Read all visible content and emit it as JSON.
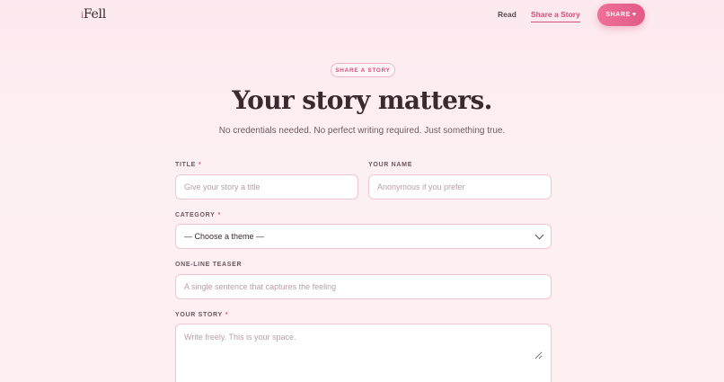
{
  "nav": {
    "logo_prefix": "i",
    "logo_text": "Fell",
    "links": [
      {
        "label": "Read"
      },
      {
        "label": "Share a Story"
      }
    ],
    "cta_label": "SHARE",
    "cta_icon": "heart-icon"
  },
  "hero": {
    "pill": "SHARE A STORY",
    "title": "Your story matters.",
    "subtitle": "No credentials needed. No perfect writing required. Just something true."
  },
  "form": {
    "title": {
      "label": "TITLE",
      "required": "*",
      "placeholder": "Give your story a title"
    },
    "name": {
      "label": "YOUR NAME",
      "placeholder": "Anonymous if you prefer"
    },
    "category": {
      "label": "CATEGORY",
      "required": "*",
      "value": "— Choose a theme —"
    },
    "teaser": {
      "label": "ONE-LINE TEASER",
      "placeholder": "A single sentence that captures the feeling"
    },
    "story": {
      "label": "YOUR STORY",
      "required": "*",
      "placeholder": "Write freely. This is your space."
    }
  },
  "colors": {
    "accent": "#d14d78",
    "cta_gradient_start": "#f0709a",
    "cta_gradient_end": "#e25a87",
    "background": "#fde9ef"
  }
}
